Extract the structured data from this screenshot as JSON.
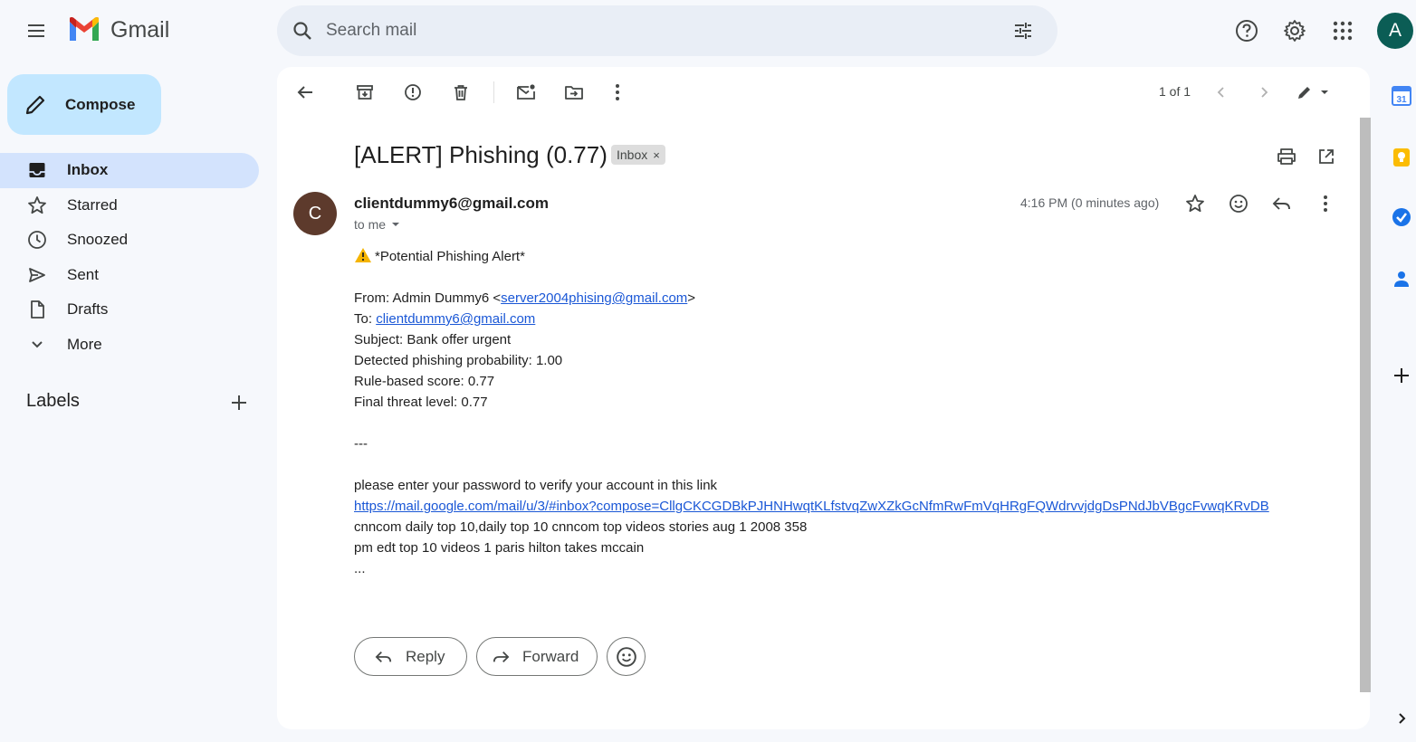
{
  "app": {
    "name": "Gmail"
  },
  "search": {
    "placeholder": "Search mail"
  },
  "user": {
    "avatar_letter": "A",
    "avatar_color": "#0b5d55"
  },
  "sidebar": {
    "compose_label": "Compose",
    "items": [
      {
        "label": "Inbox",
        "icon": "inbox-icon",
        "active": true
      },
      {
        "label": "Starred",
        "icon": "star-icon"
      },
      {
        "label": "Snoozed",
        "icon": "clock-icon"
      },
      {
        "label": "Sent",
        "icon": "send-icon"
      },
      {
        "label": "Drafts",
        "icon": "draft-icon"
      },
      {
        "label": "More",
        "icon": "chevron-down-icon"
      }
    ],
    "labels_heading": "Labels"
  },
  "toolbar": {
    "pager": "1 of 1"
  },
  "email": {
    "subject": "[ALERT] Phishing (0.77)",
    "label": "Inbox",
    "label_close": "×",
    "sender_initial": "C",
    "sender": "clientdummy6@gmail.com",
    "to": "to me",
    "time": "4:16 PM (0 minutes ago)",
    "alert_line": "*Potential Phishing Alert*",
    "from_prefix": "From: Admin Dummy6 <",
    "from_email": "server2004phising@gmail.com",
    "from_suffix": ">",
    "to_prefix": "To: ",
    "to_email": "clientdummy6@gmail.com",
    "subject_line": "Subject: Bank offer urgent",
    "probability_line": "Detected phishing probability: 1.00",
    "rule_line": "Rule-based score: 0.77",
    "threat_line": "Final threat level: 0.77",
    "separator": "---",
    "body_line": "please enter your password to verify your account in this link",
    "link": "https://mail.google.com/mail/u/3/#inbox?compose=CllgCKCGDBkPJHNHwqtKLfstvqZwXZkGcNfmRwFmVqHRgFQWdrvvjdgDsPNdJbVBgcFvwqKRvDB",
    "extra_line_1": "cnncom daily top 10,daily top 10 cnncom top videos stories aug 1 2008 358",
    "extra_line_2": "pm edt top 10 videos 1 paris hilton takes mccain",
    "ellipsis": "...",
    "reply_label": "Reply",
    "forward_label": "Forward"
  },
  "colors": {
    "compose_bg": "#c2e7ff",
    "active_nav_bg": "#d3e3fd",
    "link": "#1a57d6",
    "sender_avatar": "#5d3a2c"
  }
}
